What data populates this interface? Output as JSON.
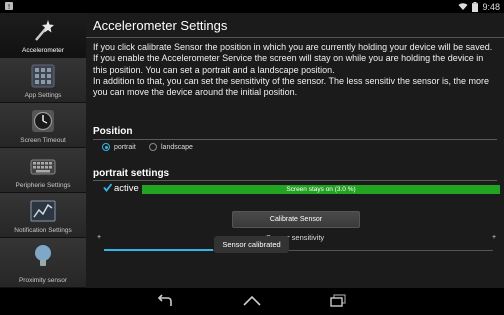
{
  "status_bar": {
    "time": "9:48"
  },
  "sidebar": {
    "items": [
      {
        "label": "Accelerometer",
        "icon": "magic-wand-icon",
        "active": true
      },
      {
        "label": "App Settings",
        "icon": "app-grid-icon",
        "active": false
      },
      {
        "label": "Screen Timeout",
        "icon": "clock-icon",
        "active": false
      },
      {
        "label": "Peripherie Settings",
        "icon": "keyboard-icon",
        "active": false
      },
      {
        "label": "Notification Settings",
        "icon": "chart-icon",
        "active": false
      },
      {
        "label": "Proximity sensor",
        "icon": "lightbulb-icon",
        "active": false
      }
    ]
  },
  "main": {
    "title": "Accelerometer Settings",
    "description": [
      "If you click calibrate Sensor the position in which you are currently holding your device will be saved.",
      "If you enable the Accelerometer Service the screen will stay on while you are holding the device in this position. You can set a portrait and a landscape position.",
      "In addition to that, you can set the sensitivity of the sensor. The less sensitiv the sensor is, the more you can move the device around the initial position."
    ],
    "position": {
      "heading": "Position",
      "options": [
        "portrait",
        "landscape"
      ],
      "selected": "portrait"
    },
    "portrait_settings": {
      "heading": "portrait settings",
      "active_label": "active",
      "active_checked": true,
      "progress_text": "Screen stays on (3.0 %)",
      "progress_value": 0.03,
      "calibrate_button": "Calibrate Sensor",
      "sensitivity_label": "Sensor sensitivity",
      "plus_left": "+",
      "plus_right": "+",
      "sensitivity_level": 0.28
    },
    "toast": "Sensor calibrated"
  },
  "colors": {
    "accent": "#33b5e5",
    "progress_green": "#22a322"
  }
}
